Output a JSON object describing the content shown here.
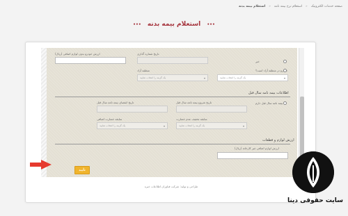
{
  "breadcrumb": {
    "items": [
      "صفحه خدمات الکترونیک",
      "استعلام نرخ بیمه نامه",
      "استعلام بیمه بدنه"
    ]
  },
  "page": {
    "title": "استعلام بیمه بدنه",
    "dots": "•••"
  },
  "form": {
    "top_labels": {
      "vehicle_value": "ارزش خودرو بدون لوازم اضافی (ریال)",
      "plate_date": "تاریخ شماره گذاری"
    },
    "free_zone_label": "خودرو در منطقه آزاد است؟",
    "free_zone_area_label": "منطقه آزاد",
    "option_no": "خیر",
    "option_yes": "آری",
    "select_placeholder": "یک گزینه را انتخاب نمایید",
    "section_prev": "اطلاعات بیمه نامه سال قبل",
    "prev_policy_radio": "بیمه نامه سال قبل دارم",
    "prev_start_label": "تاریخ شروع بیمه نامه سال قبل",
    "prev_end_label": "تاریخ انقضای بیمه نامه سال قبل",
    "prev_discount_label": "سابقه تخفیف عدم خسارت",
    "prev_extra_label": "سابقه خسارت اضافی",
    "section_accessories": "ارزش لوازم و قطعات",
    "accessories_label": "ارزش لوازم اضافی غیر کارخانه (ریال)",
    "submit_label": "تأیید"
  },
  "footer": {
    "note": "طراحی و تولید: شرکت فناوران اطلاعات خبره"
  },
  "brand": {
    "name": "سایت حقوقی دینا"
  },
  "colors": {
    "accent_title": "#a5333c",
    "button": "#f0b42d",
    "arrow": "#e63a2e",
    "form_bg": "#e4e0d4"
  }
}
